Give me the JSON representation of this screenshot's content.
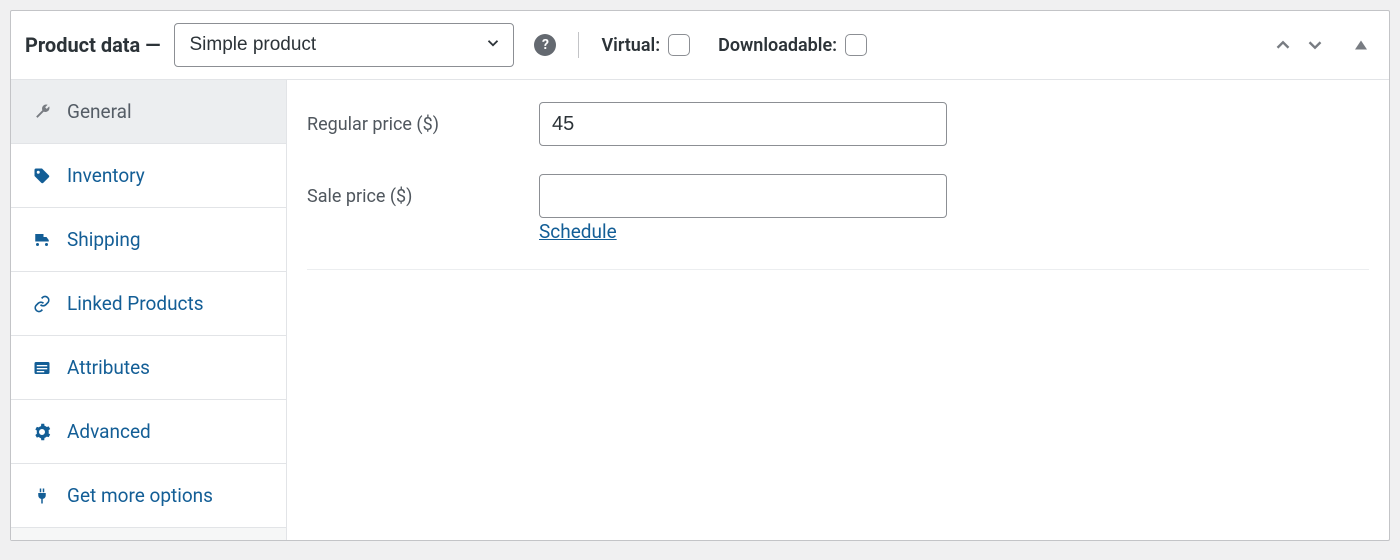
{
  "header": {
    "title": "Product data —",
    "product_type": "Simple product",
    "virtual_label": "Virtual:",
    "downloadable_label": "Downloadable:",
    "virtual_checked": false,
    "downloadable_checked": false
  },
  "sidebar": {
    "items": [
      {
        "label": "General"
      },
      {
        "label": "Inventory"
      },
      {
        "label": "Shipping"
      },
      {
        "label": "Linked Products"
      },
      {
        "label": "Attributes"
      },
      {
        "label": "Advanced"
      },
      {
        "label": "Get more options"
      }
    ]
  },
  "form": {
    "regular_price_label": "Regular price ($)",
    "regular_price_value": "45",
    "sale_price_label": "Sale price ($)",
    "sale_price_value": "",
    "schedule_label": "Schedule"
  }
}
